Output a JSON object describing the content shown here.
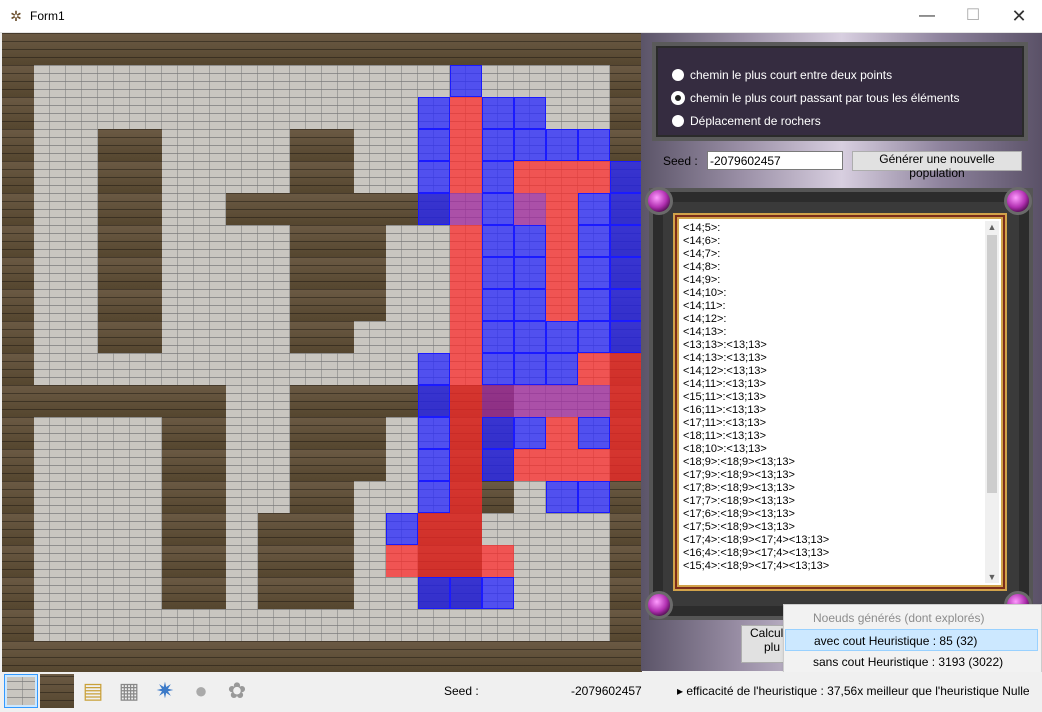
{
  "window": {
    "title": "Form1",
    "icon": "app-icon",
    "controls": {
      "minimize": "—",
      "maximize": "☐",
      "close": "✕"
    }
  },
  "grid": {
    "cols": 20,
    "rows": 20,
    "map": [
      "WWWWWWWWWWWWWWWWWWWW",
      "W..................W",
      "W..................W",
      "W..WW....WW........W",
      "W..WW....WW........W",
      "W..WW..WWWWWWW.....W",
      "W..WW....WWW.......W",
      "W..WW....WWW.......W",
      "W..WW....WWW.......W",
      "W..WW....WW........W",
      "W..................W",
      "WWWWWWW..WWWWWWW...W",
      "W....WW..WWW..WW...W",
      "W....WW..WWW..WW...W",
      "W....WW..WW...WW...W",
      "W....WW.WWW..WW....W",
      "W....WW.WWW..WW....W",
      "W....WW.WWW..WW....W",
      "W..................W",
      "WWWWWWWWWWWWWWWWWWWW"
    ],
    "overlay": [
      "....................",
      "..............B.....",
      ".............BRBB...",
      ".............BRBBBB..",
      ".............BRBRRRB",
      ".............BMBMRBB",
      "..............RBBRBB",
      "..............RBBRBB",
      "..............RBBRBB",
      "..............RBBBBB",
      ".............BRBBBRR",
      ".............BRMMMMR",
      ".............BRBBRBR",
      ".............BRBRRRR",
      ".............BR..BB.",
      "............BRR.....",
      "............RRRR....",
      ".............BBB....",
      "....................",
      "...................."
    ]
  },
  "options": [
    {
      "label": "chemin le plus court entre deux points",
      "selected": false
    },
    {
      "label": "chemin le plus court passant par tous les éléments",
      "selected": true
    },
    {
      "label": "Déplacement de rochers",
      "selected": false
    }
  ],
  "seed": {
    "label": "Seed :",
    "value": "-2079602457",
    "button": "Générer une nouvelle population"
  },
  "list": {
    "items": [
      "<14;5>:",
      "<14;6>:",
      "<14;7>:",
      "<14;8>:",
      "<14;9>:",
      "<14;10>:",
      "<14;11>:",
      "<14;12>:",
      "<14;13>:",
      "<13;13>:<13;13>",
      "<14;13>:<13;13>",
      "<14;12>:<13;13>",
      "<14;11>:<13;13>",
      "<15;11>:<13;13>",
      "<16;11>:<13;13>",
      "<17;11>:<13;13>",
      "<18;11>:<13;13>",
      "<18;10>:<13;13>",
      "<18;9>:<18;9><13;13>",
      "<17;9>:<18;9><13;13>",
      "<17;8>:<18;9><13;13>",
      "<17;7>:<18;9><13;13>",
      "<17;6>:<18;9><13;13>",
      "<17;5>:<18;9><13;13>",
      "<17;4>:<18;9><17;4><13;13>",
      "<16;4>:<18;9><17;4><13;13>",
      "<15;4>:<18;9><17;4><13;13>"
    ],
    "scroll_up": "▲",
    "scroll_down": "▼"
  },
  "calc_button": {
    "line1": "Calculer",
    "line2": "plu"
  },
  "popup": {
    "items": [
      {
        "label": "Noeuds générés (dont explorés)",
        "disabled": true
      },
      {
        "label": "avec cout Heuristique : 85 (32)",
        "selected": true
      },
      {
        "label": "sans cout Heuristique : 3193 (3022)"
      }
    ]
  },
  "status": {
    "seed_label": "Seed :",
    "seed_value": "-2079602457",
    "efficiency": "▸ efficacité de l'heuristique : 37,56x meilleur que l'heuristique Nulle"
  },
  "tools": [
    "floor-tile-icon",
    "wall-tile-icon",
    "coins-icon",
    "shelf-icon",
    "crystal-icon",
    "rock-icon",
    "plant-icon"
  ],
  "colors": {
    "blue_overlay": "#2828ff",
    "red_overlay": "#ff2828",
    "selection": "#cce8ff"
  }
}
